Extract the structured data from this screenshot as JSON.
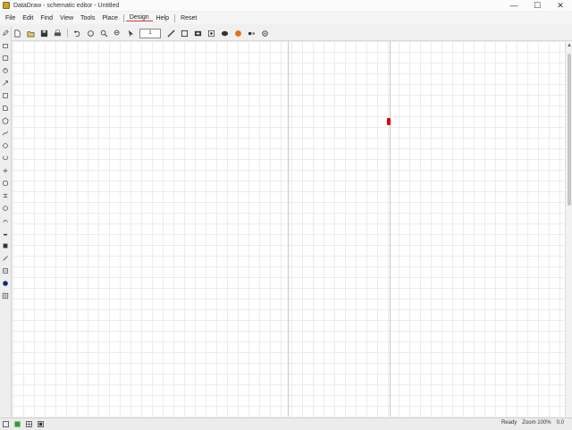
{
  "window": {
    "title": "DataDraw - schematic editor - Untitled",
    "minimize_glyph": "—",
    "maximize_glyph": "☐",
    "close_glyph": "✕"
  },
  "menubar": {
    "items": [
      {
        "label": "File"
      },
      {
        "label": "Edit"
      },
      {
        "label": "Find"
      },
      {
        "label": "View"
      },
      {
        "label": "Tools"
      },
      {
        "label": "Place"
      },
      {
        "label": "Design"
      },
      {
        "label": "Help"
      },
      {
        "label": "Reset"
      }
    ],
    "active_index": 6
  },
  "toolbar": {
    "zoom_value": "1",
    "icons": [
      "new-icon",
      "open-icon",
      "save-icon",
      "print-icon",
      "undo-icon",
      "redo-icon",
      "zoom-in-icon",
      "zoom-out-icon",
      "select-icon",
      "wire-icon",
      "box-icon",
      "component-icon",
      "camera-icon",
      "ellipse-icon",
      "color-fill-icon",
      "eye-icon",
      "settings-icon"
    ]
  },
  "toolbox": {
    "icons": [
      "pencil-icon",
      "eraser-icon",
      "text-icon",
      "line-icon",
      "arrow-icon",
      "rect-icon",
      "circle-icon",
      "polygon-icon",
      "curve-icon",
      "label-icon",
      "node-icon",
      "bus-icon",
      "port-icon",
      "junction-icon",
      "ground-icon",
      "power-icon",
      "pin-icon",
      "net-icon",
      "fill-icon",
      "brush-icon",
      "probe-icon",
      "measure-icon"
    ]
  },
  "canvas": {
    "marker_color": "#e00000",
    "grid_color": "#ececec",
    "background": "#ffffff"
  },
  "statusbar": {
    "left_items": [
      "",
      "",
      "",
      ""
    ],
    "right_items": [
      "Ready",
      "Zoom 100%",
      "0,0"
    ]
  }
}
